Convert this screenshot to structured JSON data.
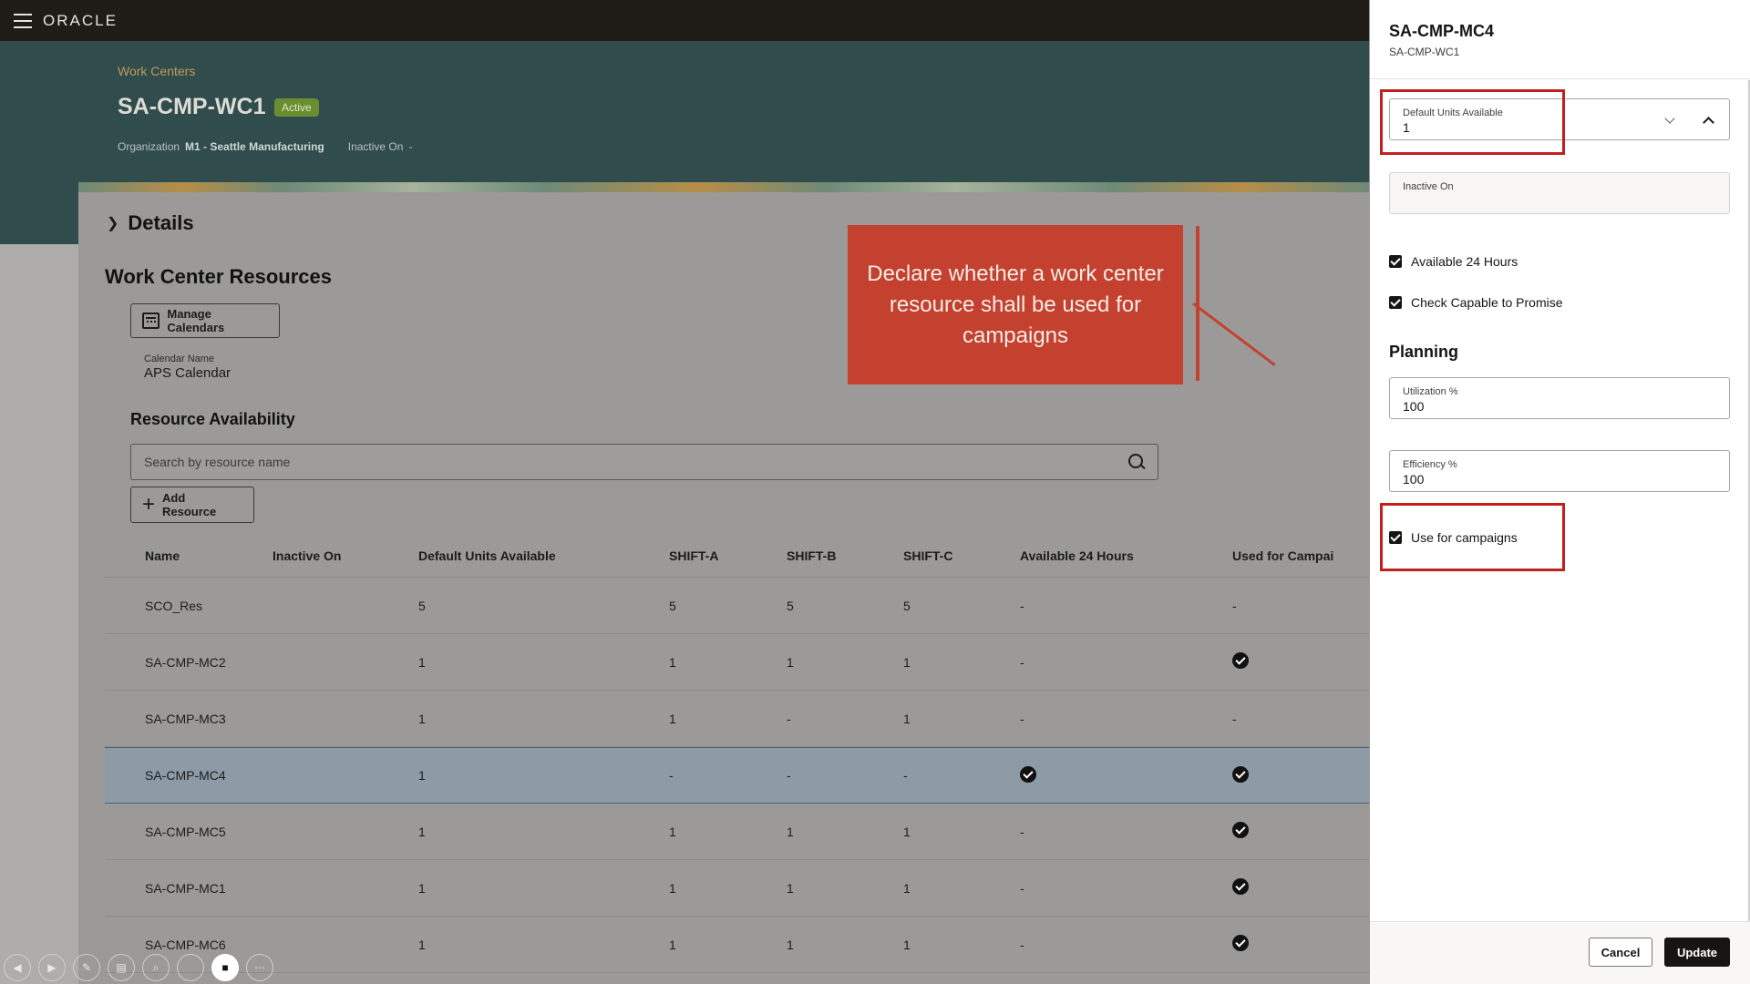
{
  "app": {
    "logo": "ORACLE"
  },
  "header": {
    "breadcrumb": "Work Centers",
    "title": "SA-CMP-WC1",
    "status": "Active",
    "org_label": "Organization",
    "org_value": "M1 - Seattle Manufacturing",
    "inactive_label": "Inactive On",
    "inactive_value": "-"
  },
  "main": {
    "details_label": "Details",
    "section_title": "Work Center Resources",
    "manage_calendars": "Manage Calendars",
    "calendar_label": "Calendar Name",
    "calendar_value": "APS Calendar",
    "availability_title": "Resource Availability",
    "search_placeholder": "Search by resource name",
    "add_resource": "Add Resource"
  },
  "table": {
    "columns": [
      "Name",
      "Inactive On",
      "Default Units Available",
      "SHIFT-A",
      "SHIFT-B",
      "SHIFT-C",
      "Available 24 Hours",
      "Used for Campai"
    ],
    "rows": [
      {
        "name": "SCO_Res",
        "inactive": "",
        "units": "5",
        "a": "5",
        "b": "5",
        "c": "5",
        "avail24": "-",
        "campaign": "-"
      },
      {
        "name": "SA-CMP-MC2",
        "inactive": "",
        "units": "1",
        "a": "1",
        "b": "1",
        "c": "1",
        "avail24": "-",
        "campaign": "check"
      },
      {
        "name": "SA-CMP-MC3",
        "inactive": "",
        "units": "1",
        "a": "1",
        "b": "-",
        "c": "1",
        "avail24": "-",
        "campaign": "-"
      },
      {
        "name": "SA-CMP-MC4",
        "inactive": "",
        "units": "1",
        "a": "-",
        "b": "-",
        "c": "-",
        "avail24": "check",
        "campaign": "check"
      },
      {
        "name": "SA-CMP-MC5",
        "inactive": "",
        "units": "1",
        "a": "1",
        "b": "1",
        "c": "1",
        "avail24": "-",
        "campaign": "check"
      },
      {
        "name": "SA-CMP-MC1",
        "inactive": "",
        "units": "1",
        "a": "1",
        "b": "1",
        "c": "1",
        "avail24": "-",
        "campaign": "check"
      },
      {
        "name": "SA-CMP-MC6",
        "inactive": "",
        "units": "1",
        "a": "1",
        "b": "1",
        "c": "1",
        "avail24": "-",
        "campaign": "check"
      }
    ],
    "selected_row": 3
  },
  "callout": {
    "text": "Declare whether a work center resource shall be used for campaigns"
  },
  "drawer": {
    "title": "SA-CMP-MC4",
    "subtitle": "SA-CMP-WC1",
    "default_units_label": "Default Units Available",
    "default_units_value": "1",
    "inactive_label": "Inactive On",
    "inactive_value": "",
    "available24_label": "Available 24 Hours",
    "available24_checked": true,
    "ctp_label": "Check Capable to Promise",
    "ctp_checked": true,
    "planning_title": "Planning",
    "utilization_label": "Utilization %",
    "utilization_value": "100",
    "efficiency_label": "Efficiency %",
    "efficiency_value": "100",
    "campaigns_label": "Use for campaigns",
    "campaigns_checked": true,
    "cancel_label": "Cancel",
    "update_label": "Update"
  },
  "colors": {
    "accent_red": "#c44130",
    "header_teal": "#304c4c",
    "status_green": "#6a8d2f"
  },
  "controls": [
    "chevron-left-icon",
    "chevron-right-icon",
    "pen-icon",
    "layout-icon",
    "zoom-icon",
    "circle-icon",
    "video-icon",
    "more-icon"
  ]
}
